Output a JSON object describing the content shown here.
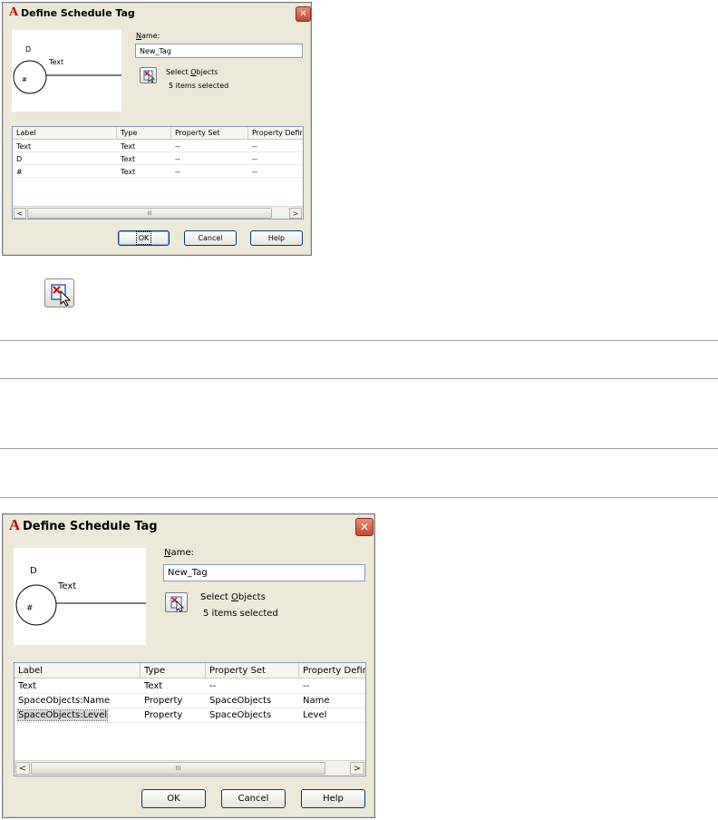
{
  "dialog": {
    "title": "Define Schedule Tag",
    "close_symbol": "✕",
    "app_icon_letter": "A",
    "name_label_first": "N",
    "name_label_rest": "ame:",
    "name_value": "New_Tag",
    "select_label_pre": "Select ",
    "select_label_u": "O",
    "select_label_post": "bjects",
    "items_selected": "5 items selected",
    "preview": {
      "tag_text": "Text",
      "top_mark": "D",
      "circle_mark": "#"
    },
    "columns": [
      "Label",
      "Type",
      "Property Set",
      "Property Defir"
    ],
    "ok_label": "OK",
    "cancel_label": "Cancel",
    "help_label": "Help",
    "scroll_left": "<",
    "scroll_right": ">",
    "scroll_grip": "III"
  },
  "top_dialog": {
    "rows": [
      [
        "Text",
        "Text",
        "--",
        "--"
      ],
      [
        "D",
        "Text",
        "--",
        "--"
      ],
      [
        "#",
        "Text",
        "--",
        "--"
      ]
    ]
  },
  "bottom_dialog": {
    "rows": [
      [
        "Text",
        "Text",
        "--",
        "--"
      ],
      [
        "SpaceObjects:Name",
        "Property",
        "SpaceObjects",
        "Name"
      ],
      [
        "SpaceObjects:Level",
        "Property",
        "SpaceObjects",
        "Level"
      ]
    ]
  },
  "icons": {
    "select_objects": "select-objects-icon",
    "close": "close-icon",
    "app": "autocad-app-icon"
  },
  "colors": {
    "dialog_bg": "#ece9d8",
    "close_red": "#c9472f",
    "select_red": "#cc0000"
  }
}
